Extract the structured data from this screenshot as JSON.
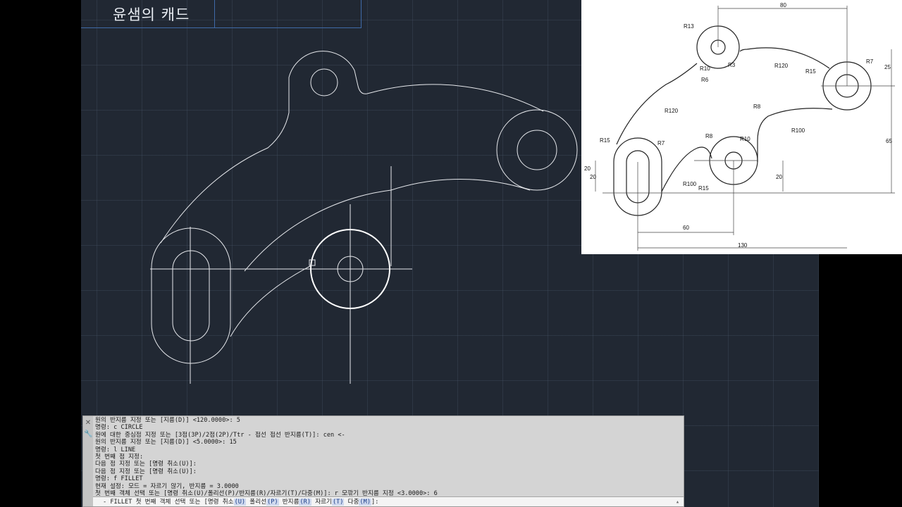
{
  "title": "윤샘의 캐드",
  "reference_drawing": {
    "dims_text": [
      "80",
      "R13",
      "R10",
      "R3",
      "R120",
      "R7",
      "R15",
      "25",
      "R6",
      "R120",
      "R8",
      "R100",
      "R7",
      "R15",
      "65",
      "R8",
      "R10",
      "20",
      "20",
      "R100",
      "R15",
      "20",
      "60",
      "130"
    ]
  },
  "command_history": [
    "원의 반지름 지정 또는 [지름(D)] <120.0000>: 5",
    "명령: c CIRCLE",
    "원에 대한 중심점 지정 또는 [3점(3P)/2점(2P)/Ttr - 접선 접선 반지름(T)]: cen <-",
    "원의 반지름 지정 또는 [지름(D)] <5.0000>: 15",
    "명령: l LINE",
    "첫 번째 점 지정:",
    "다음 점 지정 또는 [명령 취소(U)]:",
    "다음 점 지정 또는 [명령 취소(U)]:",
    "명령: f FILLET",
    "현재 설정: 모드 = 자르기 않기, 반지름 = 3.0000",
    "첫 번째 객체 선택 또는 [명령 취소(U)/폴리선(P)/반지름(R)/자르기(T)/다중(M)]: r 모깎기 반지름 지정 <3.0000>: 6"
  ],
  "command_input": {
    "prompt": "- FILLET 첫 번째 객체 선택 또는 [명령 취소",
    "options": [
      "(U)",
      "폴리선",
      "(P)",
      "반지름",
      "(R)",
      "자르기",
      "(T)",
      "다중",
      "(M)"
    ],
    "suffix": "]:"
  },
  "side_icons": [
    "close-icon",
    "wrench-icon"
  ]
}
